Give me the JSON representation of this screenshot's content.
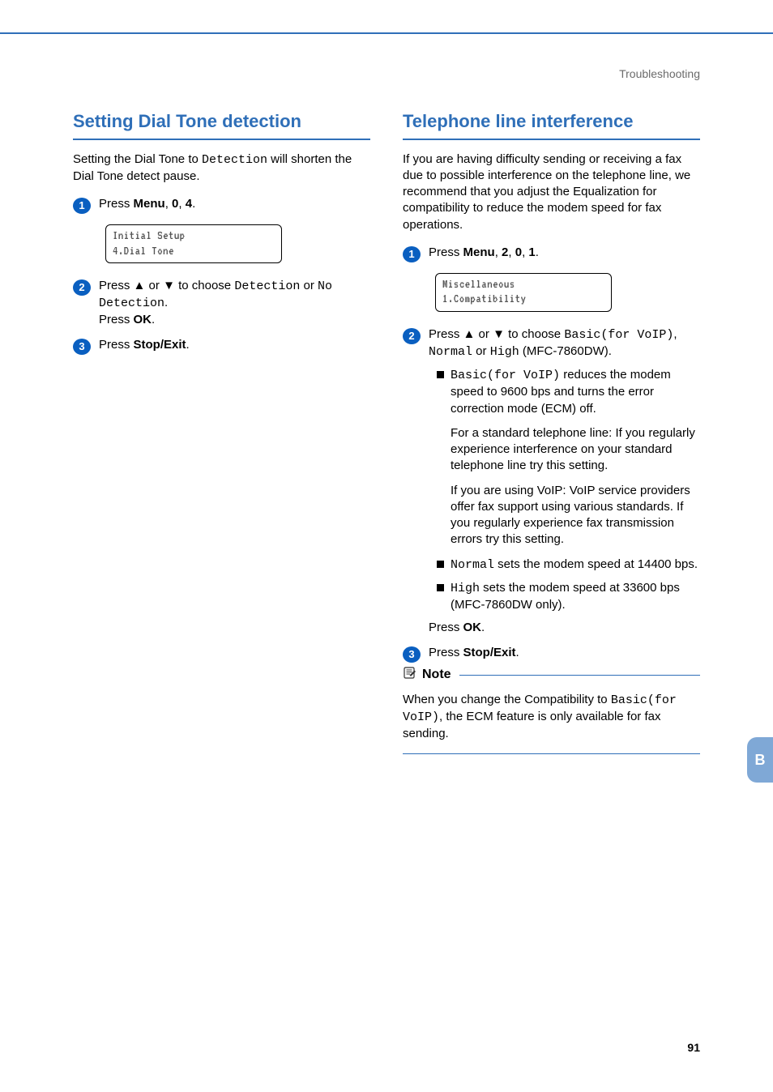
{
  "header": {
    "section": "Troubleshooting"
  },
  "side_tab": "B",
  "page_number": "91",
  "left": {
    "heading": "Setting Dial Tone detection",
    "intro_pre": "Setting the Dial Tone to ",
    "intro_mono": "Detection",
    "intro_post": " will shorten the Dial Tone detect pause.",
    "step1": {
      "pre": "Press ",
      "menu": "Menu",
      "sep1": ", ",
      "k1": "0",
      "sep2": ", ",
      "k2": "4",
      "end": "."
    },
    "lcd1_line1": "Initial Setup",
    "lcd1_line2": "4.Dial Tone",
    "step2": {
      "pre": "Press ",
      "mid": " or ",
      "post_pre": " to choose ",
      "opt1": "Detection",
      "or": " or ",
      "opt2": "No Detection",
      "end": ".",
      "press": "Press ",
      "ok": "OK",
      "dot": "."
    },
    "step3": {
      "press": "Press ",
      "stop": "Stop/Exit",
      "dot": "."
    }
  },
  "right": {
    "heading": "Telephone line interference",
    "intro": "If you are having difficulty sending or receiving a fax due to possible interference on the telephone line, we recommend that you adjust the Equalization for compatibility to reduce the modem speed for fax operations.",
    "step1": {
      "pre": "Press ",
      "menu": "Menu",
      "sep1": ", ",
      "k1": "2",
      "sep2": ", ",
      "k2": "0",
      "sep3": ", ",
      "k3": "1",
      "end": "."
    },
    "lcd1_line1": "Miscellaneous",
    "lcd1_line2": "1.Compatibility",
    "step2": {
      "pre": "Press ",
      "mid": " or ",
      "post_pre": " to choose ",
      "opt1": "Basic(for VoIP)",
      "sep1": ", ",
      "opt2": "Normal",
      "or": " or ",
      "opt3": "High",
      "model": " (MFC-7860DW)."
    },
    "b1": {
      "mono": "Basic(for VoIP)",
      "rest": " reduces the modem speed to 9600 bps and turns the error correction mode (ECM) off.",
      "p1": "For a standard telephone line: If you regularly experience interference on your standard telephone line try this setting.",
      "p2": "If you are using VoIP: VoIP service providers offer fax support using various standards. If you regularly experience fax transmission errors try this setting."
    },
    "b2": {
      "mono": "Normal",
      "rest": " sets the modem speed at 14400 bps."
    },
    "b3": {
      "mono": "High",
      "rest": " sets the modem speed at 33600 bps (MFC-7860DW only)."
    },
    "press_ok": {
      "press": "Press ",
      "ok": "OK",
      "dot": "."
    },
    "step3": {
      "press": "Press ",
      "stop": "Stop/Exit",
      "dot": "."
    },
    "note": {
      "title": "Note",
      "pre": "When you change the Compatibility to ",
      "mono": "Basic(for VoIP)",
      "post": ", the ECM feature is only available for fax sending."
    }
  }
}
